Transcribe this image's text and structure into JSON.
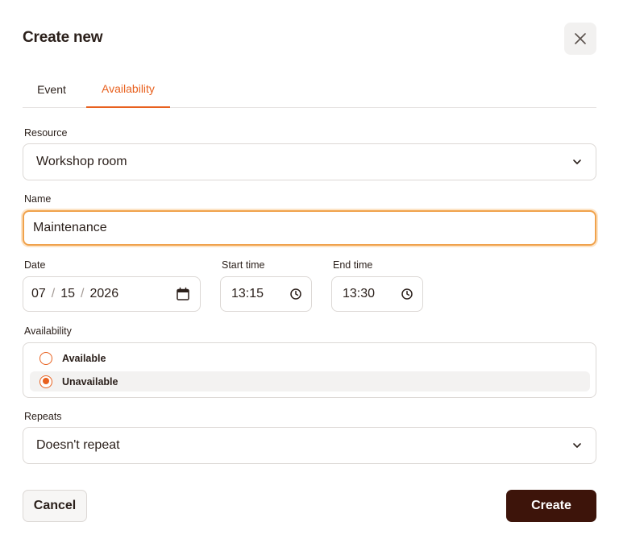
{
  "dialog": {
    "title": "Create new",
    "close_icon": "close-icon"
  },
  "tabs": [
    {
      "label": "Event",
      "active": false
    },
    {
      "label": "Availability",
      "active": true
    }
  ],
  "resource": {
    "label": "Resource",
    "value": "Workshop room",
    "icon": "chevron-down-icon"
  },
  "name": {
    "label": "Name",
    "value": "Maintenance"
  },
  "date": {
    "label": "Date",
    "month": "07",
    "day": "15",
    "year": "2026",
    "separator": "/",
    "icon": "calendar-icon"
  },
  "start_time": {
    "label": "Start time",
    "value": "13:15",
    "icon": "clock-icon"
  },
  "end_time": {
    "label": "End time",
    "value": "13:30",
    "icon": "clock-icon"
  },
  "availability": {
    "label": "Availability",
    "options": [
      {
        "label": "Available",
        "checked": false
      },
      {
        "label": "Unavailable",
        "checked": true
      }
    ]
  },
  "repeats": {
    "label": "Repeats",
    "value": "Doesn't repeat",
    "icon": "chevron-down-icon"
  },
  "actions": {
    "cancel_label": "Cancel",
    "create_label": "Create"
  },
  "colors": {
    "accent": "#e8611f",
    "primary_button": "#3d140a",
    "focus_ring": "#f0a24c",
    "text": "#2a1f1a"
  }
}
